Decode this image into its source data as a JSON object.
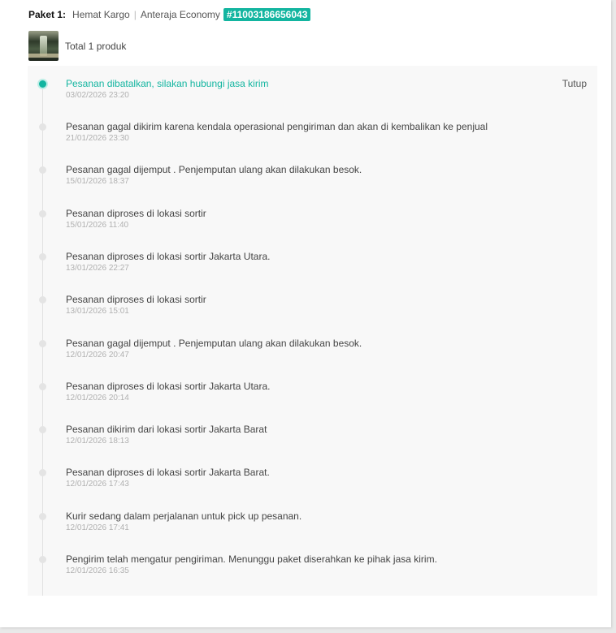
{
  "package": {
    "label": "Paket 1:",
    "courier": "Hemat Kargo",
    "separator": "|",
    "service": "Anteraja Economy",
    "tracking_number": "#11003186656043"
  },
  "product": {
    "thumbnail_icon": "product-image",
    "total_label": "Total 1 produk"
  },
  "timeline": {
    "close_label": "Tutup",
    "accent_color": "#13b5a0",
    "events": [
      {
        "text": "Pesanan dibatalkan, silakan hubungi jasa kirim",
        "time": "03/02/2026 23:20",
        "active": true
      },
      {
        "text": "Pesanan gagal dikirim karena kendala operasional pengiriman dan akan di kembalikan ke penjual",
        "time": "21/01/2026 23:30",
        "active": false
      },
      {
        "text": "Pesanan gagal dijemput . Penjemputan ulang akan dilakukan besok.",
        "time": "15/01/2026 18:37",
        "active": false
      },
      {
        "text": "Pesanan diproses di lokasi sortir",
        "time": "15/01/2026 11:40",
        "active": false
      },
      {
        "text": "Pesanan diproses di lokasi sortir Jakarta Utara.",
        "time": "13/01/2026 22:27",
        "active": false
      },
      {
        "text": "Pesanan diproses di lokasi sortir",
        "time": "13/01/2026 15:01",
        "active": false
      },
      {
        "text": "Pesanan gagal dijemput . Penjemputan ulang akan dilakukan besok.",
        "time": "12/01/2026 20:47",
        "active": false
      },
      {
        "text": "Pesanan diproses di lokasi sortir Jakarta Utara.",
        "time": "12/01/2026 20:14",
        "active": false
      },
      {
        "text": "Pesanan dikirim dari lokasi sortir Jakarta Barat",
        "time": "12/01/2026 18:13",
        "active": false
      },
      {
        "text": "Pesanan diproses di lokasi sortir Jakarta Barat.",
        "time": "12/01/2026 17:43",
        "active": false
      },
      {
        "text": "Kurir sedang dalam perjalanan untuk pick up pesanan.",
        "time": "12/01/2026 17:41",
        "active": false
      },
      {
        "text": "Pengirim telah mengatur pengiriman. Menunggu paket diserahkan ke pihak jasa kirim.",
        "time": "12/01/2026 16:35",
        "active": false
      }
    ]
  }
}
